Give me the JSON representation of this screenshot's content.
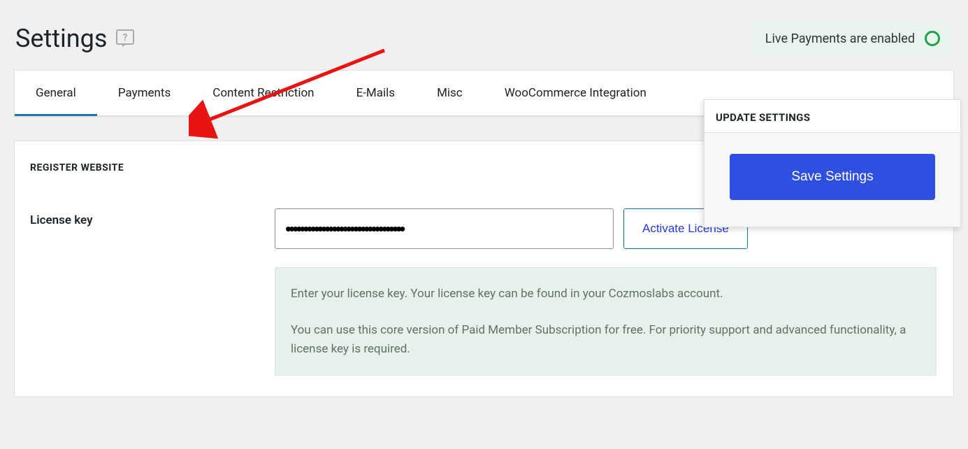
{
  "header": {
    "title": "Settings",
    "status_text": "Live Payments are enabled"
  },
  "tabs": [
    {
      "label": "General"
    },
    {
      "label": "Payments"
    },
    {
      "label": "Content Restriction"
    },
    {
      "label": "E-Mails"
    },
    {
      "label": "Misc"
    },
    {
      "label": "WooCommerce Integration"
    }
  ],
  "content": {
    "section_heading": "REGISTER WEBSITE",
    "license_label": "License key",
    "license_value": "•••••••••••••••••••••••••••••••••",
    "activate_button": "Activate License",
    "info_line1": "Enter your license key. Your license key can be found in your Cozmoslabs account.",
    "info_line2": "You can use this core version of Paid Member Subscription for free. For priority support and advanced functionality, a license key is required."
  },
  "sidebar": {
    "heading": "UPDATE SETTINGS",
    "save_button": "Save Settings"
  }
}
